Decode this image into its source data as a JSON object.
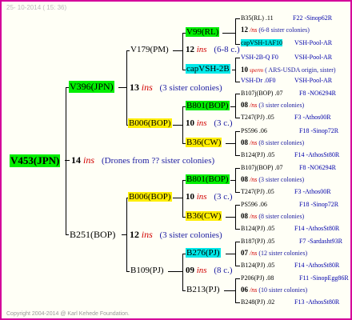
{
  "header": {
    "date": "25- 10-2014 ( 15: 36)"
  },
  "footer": {
    "copyright": "Copyright 2004-2014 @ Karl Kehede Foundation."
  },
  "colors": {
    "frame_border": "#d4009a",
    "green_box": "#00ee00",
    "yellow_box": "#ffee00",
    "cyan_box": "#00e8e8",
    "ins_red": "#d20000",
    "note_blue": "#1a1aa0"
  },
  "root": {
    "name": "V453(JPN)",
    "count": "14",
    "ins": "ins",
    "note": "(Drones from ?? sister colonies)"
  },
  "gen1": {
    "top": {
      "name": "V396(JPN)",
      "count": "13",
      "ins": "ins",
      "note": "(3 sister colonies)"
    },
    "bottom": {
      "name": "B251(BOP)",
      "count": "12",
      "ins": "ins",
      "note": "(3 sister colonies)"
    }
  },
  "gen2": {
    "tt": {
      "name": "V179(PM)",
      "count": "12",
      "ins": "ins",
      "note": "(6-8 c.)"
    },
    "tb": {
      "name": "B006(BOP)",
      "count": "10",
      "ins": "ins",
      "note": "(3 c.)"
    },
    "bt": {
      "name": "B006(BOP)",
      "count": "10",
      "ins": "ins",
      "note": "(3 c.)"
    },
    "bb": {
      "name": "B109(PJ)",
      "count": "09",
      "ins": "ins",
      "note": "(8 c.)"
    }
  },
  "gen3": [
    {
      "name": "V99(RL)"
    },
    {
      "name": "capVSH-2B"
    },
    {
      "name": "B801(BOP)"
    },
    {
      "name": "B36(CW)"
    },
    {
      "name": "B801(BOP)"
    },
    {
      "name": "B36(CW)"
    },
    {
      "name": "B276(PJ)"
    },
    {
      "name": "B213(PJ)"
    }
  ],
  "gen4": [
    {
      "top": "B35(RL) .11",
      "top_right": "F22 -Sinop62R",
      "count": "12",
      "ins": "/ns",
      "note": "(6-8 sister colonies)",
      "bottom": "capVSH-1AF10",
      "bottom_right": "VSH-Pool-AR"
    },
    {
      "top": "VSH-2B-Q F0",
      "top_right": "VSH-Pool-AR",
      "count": "10",
      "ins": "sperm",
      "note": "( ARS-USDA origin, sister)",
      "bottom": "VSH-Dr .0F0",
      "bottom_right": "VSH-Pool-AR"
    },
    {
      "top": "B107j(BOP) .07",
      "top_right": "F8 -NO6294R",
      "count": "08",
      "ins": "/ns",
      "note": "(3 sister colonies)",
      "bottom": "T247(PJ) .05",
      "bottom_right": "F3 -Athos00R"
    },
    {
      "top": "PS596 .06",
      "top_right": "F18 -Sinop72R",
      "count": "08",
      "ins": "/ns",
      "note": "(8 sister colonies)",
      "bottom": "B124(PJ) .05",
      "bottom_right": "F14 -AthosSt80R"
    },
    {
      "top": "B107j(BOP) .07",
      "top_right": "F8 -NO6294R",
      "count": "08",
      "ins": "/ns",
      "note": "(3 sister colonies)",
      "bottom": "T247(PJ) .05",
      "bottom_right": "F3 -Athos00R"
    },
    {
      "top": "PS596 .06",
      "top_right": "F18 -Sinop72R",
      "count": "08",
      "ins": "/ns",
      "note": "(8 sister colonies)",
      "bottom": "B124(PJ) .05",
      "bottom_right": "F14 -AthosSt80R"
    },
    {
      "top": "B187(PJ) .05",
      "top_right": "F7 -Sardasht93R",
      "count": "07",
      "ins": "/ns",
      "note": "(12 sister colonies)",
      "bottom": "B124(PJ) .05",
      "bottom_right": "F14 -AthosSt80R"
    },
    {
      "top": "P206(PJ) .08",
      "top_right": "F11 -SinopEgg86R",
      "count": "06",
      "ins": "/ns",
      "note": "(10 sister colonies)",
      "bottom": "B248(PJ) .02",
      "bottom_right": "F13 -AthosSt80R"
    }
  ]
}
